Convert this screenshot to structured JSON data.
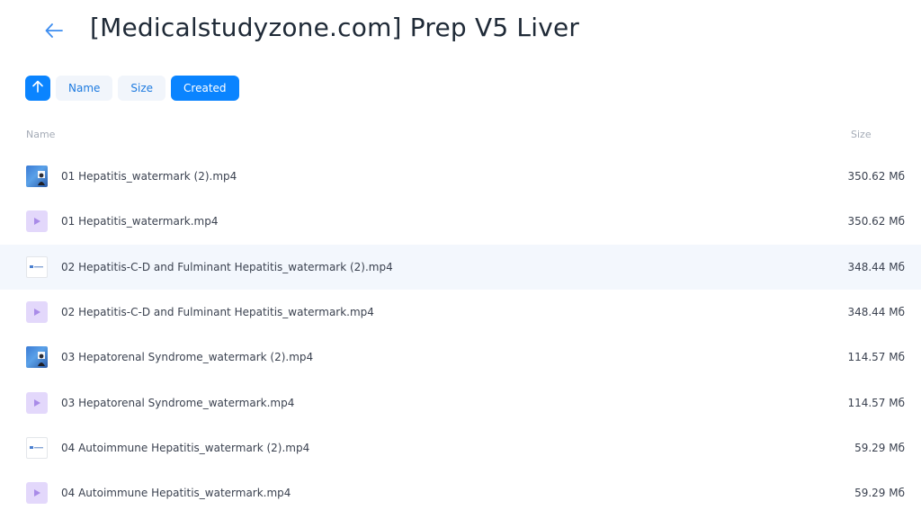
{
  "header": {
    "back_icon": "arrow-left-icon",
    "title": "[Medicalstudyzone.com] Prep V5 Liver"
  },
  "sort": {
    "direction_icon": "arrow-up-icon",
    "options": [
      "Name",
      "Size",
      "Created"
    ],
    "active": "Created"
  },
  "columns": {
    "name": "Name",
    "size": "Size"
  },
  "colors": {
    "accent": "#0a84ff",
    "video_icon_bg": "#e3d8fb",
    "row_hover": "#f3f7fd"
  },
  "files": [
    {
      "name": "01 Hepatitis_watermark (2).mp4",
      "size": "350.62 Мб",
      "thumb": "photo-thumbnail"
    },
    {
      "name": "01 Hepatitis_watermark.mp4",
      "size": "350.62 Мб",
      "thumb": "video-icon"
    },
    {
      "name": "02 Hepatitis-C-D and Fulminant Hepatitis_watermark (2).mp4",
      "size": "348.44 Мб",
      "thumb": "slide-thumbnail"
    },
    {
      "name": "02 Hepatitis-C-D and Fulminant Hepatitis_watermark.mp4",
      "size": "348.44 Мб",
      "thumb": "video-icon"
    },
    {
      "name": "03 Hepatorenal Syndrome_watermark (2).mp4",
      "size": "114.57 Мб",
      "thumb": "photo-thumbnail"
    },
    {
      "name": "03 Hepatorenal Syndrome_watermark.mp4",
      "size": "114.57 Мб",
      "thumb": "video-icon"
    },
    {
      "name": "04 Autoimmune Hepatitis_watermark (2).mp4",
      "size": "59.29 Мб",
      "thumb": "slide-thumbnail"
    },
    {
      "name": "04 Autoimmune Hepatitis_watermark.mp4",
      "size": "59.29 Мб",
      "thumb": "video-icon"
    }
  ]
}
